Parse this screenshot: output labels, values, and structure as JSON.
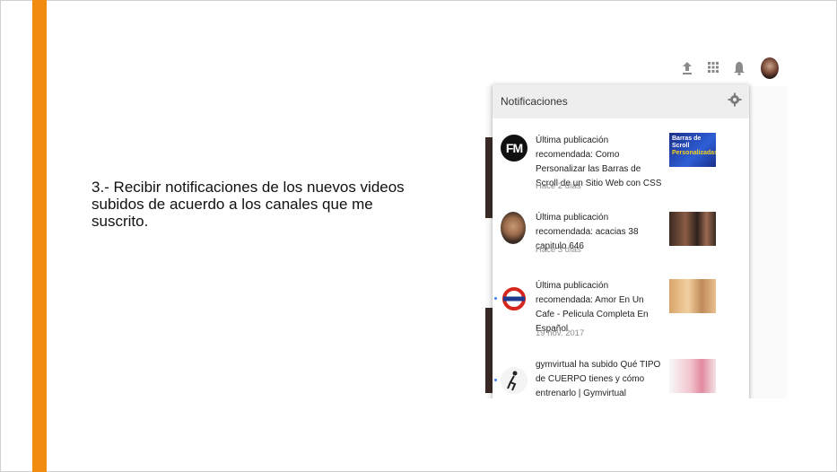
{
  "slide": {
    "bullet_text": "3.- Recibir notificaciones de los nuevos videos subidos de acuerdo a los canales que me suscrito."
  },
  "youtube": {
    "topbar_icons": [
      "upload-icon",
      "apps-grid-icon",
      "bell-icon",
      "account-avatar"
    ],
    "panel": {
      "title": "Notificaciones",
      "settings_icon": "gear-icon",
      "items": [
        {
          "avatar": "FM",
          "text": "Última publicación recomendada: Como Personalizar las Barras de Scroll de un Sitio Web con CSS",
          "time": "Hace 2 días",
          "thumb_text": [
            "Barras de",
            "Scroll",
            "Personalizadas"
          ]
        },
        {
          "avatar": "",
          "text": "Última publicación recomendada: acacias 38 capitulo 646",
          "time": "Hace 3 días"
        },
        {
          "avatar": "",
          "text": "Última publicación recomendada: Amor En Un Cafe - Pelicula Completa En Español",
          "time": "19 nov. 2017"
        },
        {
          "avatar": "",
          "text": "gymvirtual ha subido Qué TIPO de CUERPO tienes y cómo entrenarlo | Gymvirtual",
          "time": ""
        }
      ]
    },
    "colors": {
      "accent_bar": "#f08c0f",
      "panel_header": "#eeeeee",
      "unread_dot": "#3b82f6"
    }
  }
}
